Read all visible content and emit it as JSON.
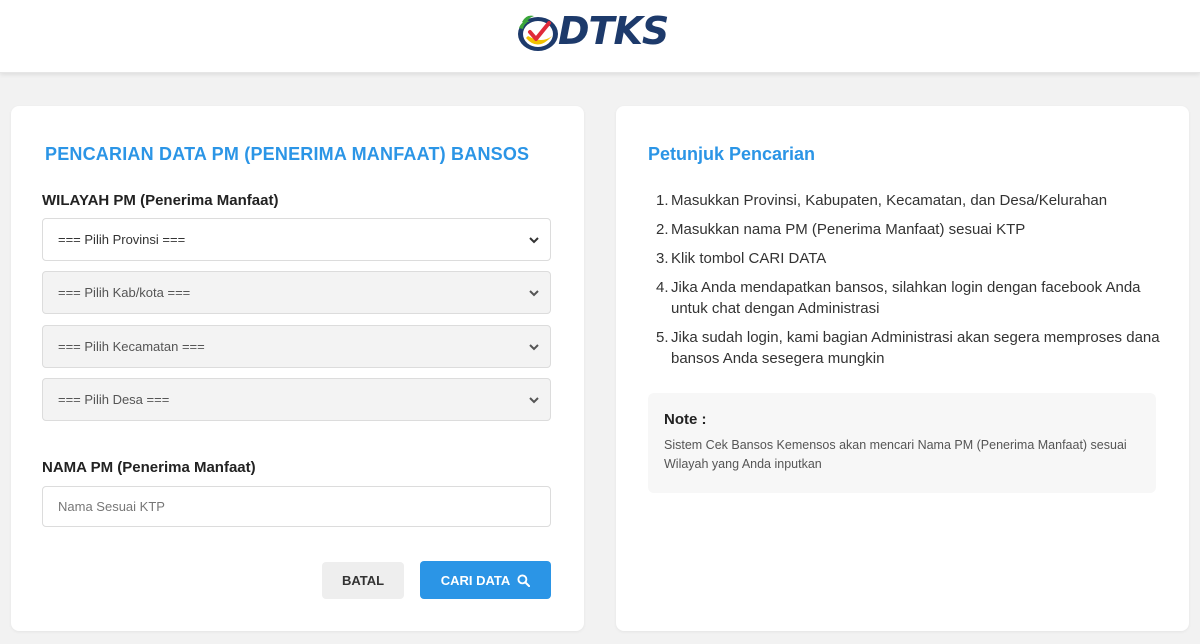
{
  "header": {
    "logo_text": "DTKS"
  },
  "search_form": {
    "title": "PENCARIAN DATA PM (PENERIMA MANFAAT) BANSOS",
    "region_label": "WILAYAH PM (Penerima Manfaat)",
    "provinsi": "=== Pilih Provinsi ===",
    "kabkota": "=== Pilih Kab/kota ===",
    "kecamatan": "=== Pilih Kecamatan ===",
    "desa": "=== Pilih Desa ===",
    "name_label": "NAMA PM (Penerima Manfaat)",
    "name_placeholder": "Nama Sesuai KTP",
    "cancel_label": "BATAL",
    "search_label": "CARI DATA"
  },
  "instructions": {
    "title": "Petunjuk Pencarian",
    "steps": [
      {
        "num": "1.",
        "text": "Masukkan Provinsi, Kabupaten, Kecamatan, dan Desa/Kelurahan"
      },
      {
        "num": "2.",
        "text": "Masukkan nama PM (Penerima Manfaat) sesuai KTP"
      },
      {
        "num": "3.",
        "text": "Klik tombol CARI DATA"
      },
      {
        "num": "4.",
        "text": "Jika Anda mendapatkan bansos, silahkan login dengan facebook Anda untuk chat dengan Administrasi"
      },
      {
        "num": "5.",
        "text": "Jika sudah login, kami bagian Administrasi akan segera memproses dana bansos Anda sesegera mungkin"
      }
    ],
    "note_title": "Note :",
    "note_text": "Sistem Cek Bansos Kemensos akan mencari Nama PM (Penerima Manfaat) sesuai Wilayah yang Anda inputkan"
  },
  "colors": {
    "accent": "#2b95e6",
    "logo_navy": "#1d3a6b"
  }
}
